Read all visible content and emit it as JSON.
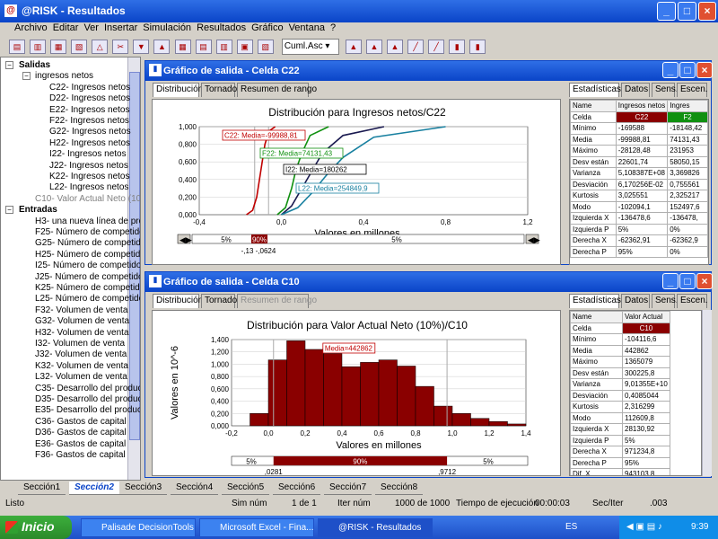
{
  "window": {
    "title": "@RISK - Resultados",
    "icon_letter": "@"
  },
  "menu": [
    "Archivo",
    "Editar",
    "Ver",
    "Insertar",
    "Simulación",
    "Resultados",
    "Gráfico",
    "Ventana",
    "?"
  ],
  "toolbar": {
    "select_value": "Cuml.Asc"
  },
  "tree": {
    "outputs_header": "Salidas",
    "outputs_group": "ingresos netos",
    "outputs": [
      "C22- Ingresos netos",
      "D22- Ingresos netos",
      "E22- Ingresos netos",
      "F22- Ingresos netos",
      "G22- Ingresos netos",
      "H22- Ingresos netos",
      "I22- Ingresos netos",
      "J22- Ingresos netos",
      "K22- Ingresos netos",
      "L22- Ingresos netos"
    ],
    "outputs_extra": "C10- Valor Actual Neto (10%",
    "inputs_header": "Entradas",
    "inputs": [
      "H3- una nueva línea de pro",
      "F25- Número de competidor",
      "G25- Número de competidor",
      "H25- Número de competidor",
      "I25- Número de competidor",
      "J25- Número de competidor",
      "K25- Número de competidor",
      "L25- Número de competidor",
      "F32- Volumen de venta",
      "G32- Volumen de venta",
      "H32- Volumen de venta",
      "I32- Volumen de venta",
      "J32- Volumen de venta",
      "K32- Volumen de venta",
      "L32- Volumen de venta",
      "C35- Desarrollo del producto",
      "D35- Desarrollo del producto",
      "E35- Desarrollo del producto",
      "C36- Gastos de capital",
      "D36- Gastos de capital",
      "E36- Gastos de capital",
      "F36- Gastos de capital"
    ]
  },
  "panel1": {
    "title": "Gráfico de salida - Celda C22",
    "tabs": [
      "Distribución",
      "Tornado",
      "Resumen de rango"
    ],
    "stats_tabs": [
      "Estadísticas",
      "Datos",
      "Sens.",
      "Escen."
    ],
    "chart_title": "Distribución para Ingresos netos/C22",
    "xlabel": "Valores en millones",
    "labels": [
      {
        "text": "C22: Media=-99988,81",
        "color": "#c00000"
      },
      {
        "text": "F22: Media=74131,43",
        "color": "#109010"
      },
      {
        "text": "I22: Media=180262",
        "color": "#000000"
      },
      {
        "text": "L22: Media=254849,9",
        "color": "#1880a0"
      }
    ],
    "slider": {
      "left": "5%",
      "mid": "90%",
      "right": "5%",
      "range": "-,13 -,0624"
    },
    "stats_header": [
      "Name",
      "Ingresos netos",
      "Ingres"
    ],
    "stats_rows": [
      [
        "Celda",
        "C22",
        "F2"
      ],
      [
        "Mínimo",
        "-169588",
        "-18148,42"
      ],
      [
        "Media",
        "-99988,81",
        "74131,43"
      ],
      [
        "Máximo",
        "-28128,48",
        "231953"
      ],
      [
        "Desv están",
        "22601,74",
        "58050,15"
      ],
      [
        "Varianza",
        "5,108387E+08",
        "3,369826"
      ],
      [
        "Desviación",
        "6,170256E-02",
        "0,755561"
      ],
      [
        "Kurtosis",
        "3,025551",
        "2,325217"
      ],
      [
        "Modo",
        "-102094,1",
        "152497,6"
      ],
      [
        "Izquierda X",
        "-136478,6",
        "-136478,"
      ],
      [
        "Izquierda P",
        "5%",
        "0%"
      ],
      [
        "Derecha X",
        "-62362,91",
        "-62362,9"
      ],
      [
        "Derecha P",
        "95%",
        "0%"
      ]
    ]
  },
  "panel2": {
    "title": "Gráfico de salida - Celda C10",
    "tabs": [
      "Distribución",
      "Tornado",
      "Resumen de rango"
    ],
    "stats_tabs": [
      "Estadísticas",
      "Datos",
      "Sens.",
      "Escen."
    ],
    "chart_title": "Distribución para Valor Actual Neto (10%)/C10",
    "xlabel": "Valores en millones",
    "ylabel": "Valores en 10^-6",
    "mean_label": "Media=442862",
    "slider": {
      "left": "5%",
      "mid": "90%",
      "right": "5%",
      "low": ",0281",
      "high": ",9712"
    },
    "stats_header": [
      "Name",
      "Valor Actual"
    ],
    "stats_rows": [
      [
        "Celda",
        "C10"
      ],
      [
        "Mínimo",
        "-104116,6"
      ],
      [
        "Media",
        "442862"
      ],
      [
        "Máximo",
        "1365079"
      ],
      [
        "Desv están",
        "300225,8"
      ],
      [
        "Varianza",
        "9,01355E+10"
      ],
      [
        "Desviación",
        "0,4085044"
      ],
      [
        "Kurtosis",
        "2,316299"
      ],
      [
        "Modo",
        "112609,8"
      ],
      [
        "Izquierda X",
        "28130,92"
      ],
      [
        "Izquierda P",
        "5%"
      ],
      [
        "Derecha X",
        "971234,8"
      ],
      [
        "Derecha P",
        "95%"
      ],
      [
        "Dif. X",
        "943103,8"
      ]
    ]
  },
  "chart_data": [
    {
      "type": "line",
      "title": "Distribución para Ingresos netos/C22",
      "xlabel": "Valores en millones",
      "ylabel": "",
      "xlim": [
        -0.4,
        1.2
      ],
      "ylim": [
        0,
        1
      ],
      "xticks": [
        "-0,4",
        "0,0",
        "0,4",
        "0,8",
        "1,2"
      ],
      "yticks": [
        "0,000",
        "0,200",
        "0,400",
        "0,600",
        "0,800",
        "1,000"
      ],
      "series": [
        {
          "name": "C22",
          "color": "#c00000",
          "x": [
            -0.17,
            -0.14,
            -0.12,
            -0.1,
            -0.08,
            -0.06,
            -0.03
          ],
          "y": [
            0,
            0.05,
            0.2,
            0.5,
            0.8,
            0.95,
            1
          ]
        },
        {
          "name": "F22",
          "color": "#109010",
          "x": [
            -0.02,
            0.02,
            0.05,
            0.07,
            0.1,
            0.14,
            0.23
          ],
          "y": [
            0,
            0.08,
            0.3,
            0.5,
            0.7,
            0.9,
            1
          ]
        },
        {
          "name": "I22",
          "color": "#1a1a50",
          "x": [
            0.0,
            0.05,
            0.1,
            0.15,
            0.2,
            0.3,
            0.5
          ],
          "y": [
            0,
            0.1,
            0.3,
            0.5,
            0.7,
            0.9,
            1
          ]
        },
        {
          "name": "L22",
          "color": "#1880a0",
          "x": [
            0.0,
            0.08,
            0.15,
            0.22,
            0.3,
            0.45,
            0.8
          ],
          "y": [
            0,
            0.08,
            0.25,
            0.45,
            0.65,
            0.88,
            1
          ]
        }
      ]
    },
    {
      "type": "bar",
      "title": "Distribución para Valor Actual Neto (10%)/C10",
      "xlabel": "Valores en millones",
      "ylabel": "Valores en 10^-6",
      "xlim": [
        -0.2,
        1.4
      ],
      "ylim": [
        0,
        1.4
      ],
      "xticks": [
        "-0,2",
        "0,0",
        "0,2",
        "0,4",
        "0,6",
        "0,8",
        "1,0",
        "1,2",
        "1,4"
      ],
      "yticks": [
        "0,000",
        "0,200",
        "0,400",
        "0,600",
        "0,800",
        "1,000",
        "1,200",
        "1,400"
      ],
      "bin_width": 0.1,
      "bins": [
        -0.1,
        0.0,
        0.1,
        0.2,
        0.3,
        0.4,
        0.5,
        0.6,
        0.7,
        0.8,
        0.9,
        1.0,
        1.1,
        1.2,
        1.3
      ],
      "values": [
        0.2,
        1.07,
        1.38,
        1.24,
        1.17,
        0.96,
        1.03,
        1.07,
        0.97,
        0.64,
        0.32,
        0.2,
        0.12,
        0.07,
        0.03
      ],
      "mean": 0.443
    }
  ],
  "sheet_tabs": [
    "Sección1",
    "Sección2",
    "Sección3",
    "Sección4",
    "Sección5",
    "Sección6",
    "Sección7",
    "Sección8"
  ],
  "status": {
    "left": "Listo",
    "sim_label": "Sim núm",
    "sim_value": "1 de 1",
    "iter_label": "Iter núm",
    "iter_value": "1000 de 1000",
    "time_label": "Tiempo de ejecución",
    "time_value": "00:00:03",
    "sec_label": "Sec/Iter",
    "sec_value": ".003"
  },
  "taskbar": {
    "start": "Inicio",
    "tasks": [
      "Palisade DecisionTools",
      "Microsoft Excel - Fina...",
      "@RISK - Resultados"
    ],
    "lang": "ES",
    "clock": "9:39"
  }
}
